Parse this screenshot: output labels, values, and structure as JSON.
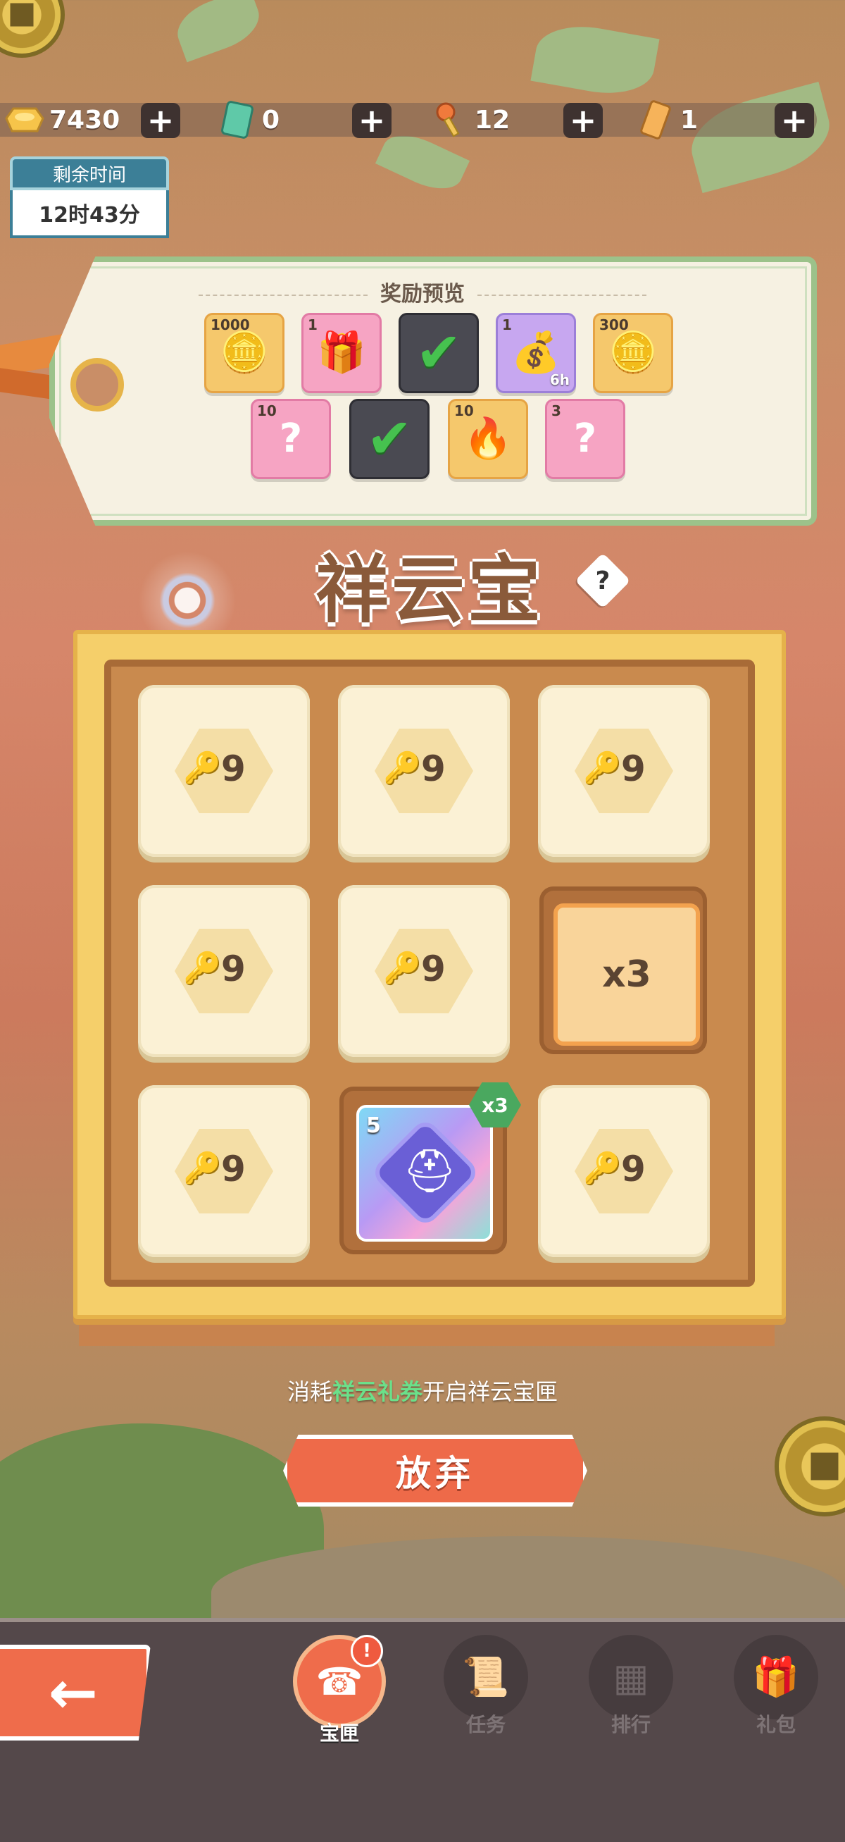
{
  "resources": {
    "gold": {
      "icon": "gold-ingot-icon",
      "value": "7430"
    },
    "ticket": {
      "icon": "green-ticket-icon",
      "value": "0"
    },
    "key": {
      "icon": "key-icon",
      "value": "12"
    },
    "coupon": {
      "icon": "coupon-icon",
      "value": "1"
    },
    "plus_label": "+"
  },
  "timer": {
    "label": "剩余时间",
    "value": "12时43分"
  },
  "reward_preview": {
    "title": "奖励预览",
    "row1": [
      {
        "type": "gold",
        "icon": "gold-ingot-icon",
        "count": "1000",
        "sub": ""
      },
      {
        "type": "pink",
        "icon": "gift-sack-icon",
        "count": "1",
        "sub": ""
      },
      {
        "type": "claimed",
        "icon": "check-icon",
        "count": "",
        "sub": ""
      },
      {
        "type": "purple",
        "icon": "coin-bag-icon",
        "count": "1",
        "sub": "6h"
      },
      {
        "type": "gold",
        "icon": "gold-ingot-icon",
        "count": "300",
        "sub": ""
      }
    ],
    "row2": [
      {
        "type": "pink",
        "icon": "mystery-puzzle-icon",
        "count": "10",
        "sub": ""
      },
      {
        "type": "claimed",
        "icon": "check-icon",
        "count": "",
        "sub": ""
      },
      {
        "type": "gold",
        "icon": "fire-token-icon",
        "count": "10",
        "sub": ""
      },
      {
        "type": "pink",
        "icon": "mystery-gem-icon",
        "count": "3",
        "sub": ""
      }
    ]
  },
  "title": "祥云宝匣",
  "help_label": "?",
  "grid": {
    "key_cost": "9",
    "multiplier_label": "x3",
    "rare_item": {
      "count": "5",
      "badge": "x3",
      "icon": "helmet-puzzle-icon"
    }
  },
  "hint": {
    "prefix": "消耗",
    "highlight": "祥云礼券",
    "suffix": "开启祥云宝匣"
  },
  "give_up_label": "放弃",
  "nav": {
    "back_label": "←",
    "tabs": [
      {
        "label": "宝匣",
        "icon": "treasure-box-icon",
        "active": true,
        "badge": "!"
      },
      {
        "label": "任务",
        "icon": "scroll-icon",
        "active": false
      },
      {
        "label": "排行",
        "icon": "ranking-banner-icon",
        "active": false
      },
      {
        "label": "礼包",
        "icon": "gift-box-icon",
        "active": false
      }
    ]
  },
  "colors": {
    "accent": "#ef6c4b",
    "highlight": "#6be08a",
    "board": "#f5cf6a"
  }
}
